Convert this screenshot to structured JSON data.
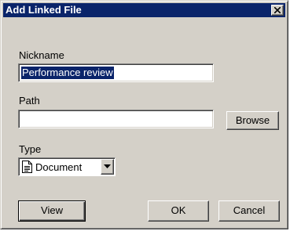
{
  "dialog": {
    "title": "Add Linked File",
    "close_icon": "close-x-icon"
  },
  "nickname": {
    "label": "Nickname",
    "value": "Performance review"
  },
  "path": {
    "label": "Path",
    "value": "",
    "browse_label": "Browse"
  },
  "type": {
    "label": "Type",
    "selected": "Document",
    "icon": "document-icon",
    "arrow_icon": "chevron-down-icon"
  },
  "buttons": {
    "view_label": "View",
    "ok_label": "OK",
    "cancel_label": "Cancel"
  },
  "colors": {
    "titlebar": "#0a246a",
    "face": "#d4d0c8",
    "selection": "#0a246a"
  }
}
